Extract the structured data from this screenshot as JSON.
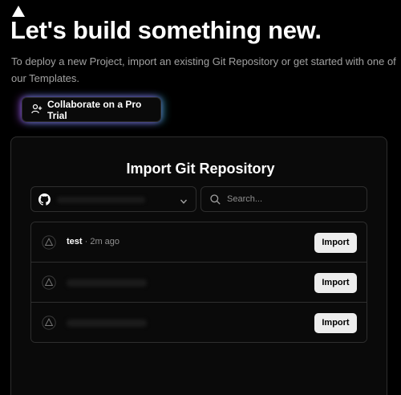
{
  "header": {
    "logo_icon": "vercel-triangle-icon",
    "title": "Let's build something new.",
    "subtitle": "To deploy a new Project, import an existing Git Repository or get started with one of our Templates."
  },
  "cta": {
    "collaborate_label": "Collaborate on a Pro Trial",
    "icon": "user-plus-icon"
  },
  "import_card": {
    "title": "Import Git Repository",
    "git_provider_icon": "github-icon",
    "search_placeholder": "Search..."
  },
  "repositories": [
    {
      "name": "test",
      "time": "· 2m ago",
      "import_label": "Import"
    },
    {
      "name": "",
      "time": "",
      "import_label": "Import"
    },
    {
      "name": "",
      "time": "",
      "import_label": "Import"
    }
  ],
  "colors": {
    "background": "#000000",
    "card": "#0a0a0a",
    "border": "#2e2e2e",
    "button": "#ededed",
    "glow_left": "#be50ff",
    "glow_right": "#3cd2e6"
  }
}
